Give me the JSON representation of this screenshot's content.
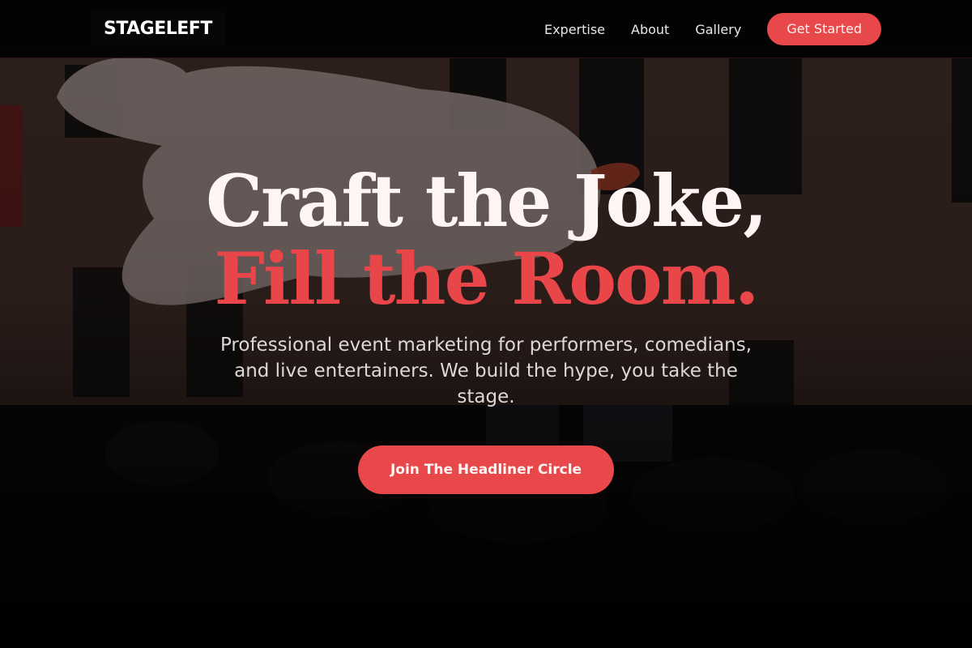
{
  "nav": {
    "logo": "STAGELEFT",
    "links": [
      {
        "label": "Expertise"
      },
      {
        "label": "About"
      },
      {
        "label": "Gallery"
      }
    ],
    "cta_label": "Get Started"
  },
  "hero": {
    "headline_line1": "Craft the Joke,",
    "headline_line2": "Fill the Room.",
    "subtitle": "Professional event marketing for performers, comedians, and live entertainers. We build the hype, you take the stage.",
    "cta_label": "Join The Headliner Circle",
    "background_image": "crowd-and-inflatable-photo"
  },
  "colors": {
    "accent": "#e8484a",
    "nav_background": "#000000",
    "headline_primary": "#fff5f4"
  }
}
